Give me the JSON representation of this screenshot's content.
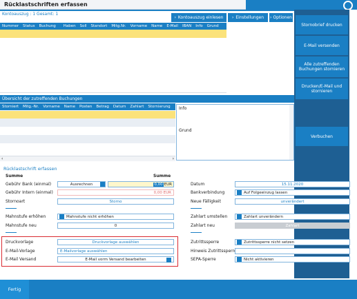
{
  "window": {
    "title": "Rücklastschriften erfassen"
  },
  "statement": {
    "text": "Kontoauszug : 1 Gesamt: 1"
  },
  "toolbar": {
    "read_statement": "Kontoauszug einlesen",
    "settings": "Einstellungen",
    "options": "Optionen"
  },
  "table1": {
    "columns": [
      "Nummer",
      "Status",
      "Buchung",
      "Haben",
      "Soll",
      "Standort",
      "Mitg.Nr.",
      "Vorname",
      "Name",
      "E-Mail",
      "IBAN",
      "Info",
      "Grund"
    ]
  },
  "side_buttons": {
    "storno_print": "Stornobrief drucken",
    "email_send": "E-Mail versenden",
    "cancel_all": "Alle zutreffenden Buchungen stornieren",
    "print_email_cancel": "Drucken/E-Mail und stornieren",
    "book": "Verbuchen"
  },
  "overview": {
    "title": "Übersicht der zutreffenden Buchungen",
    "columns": [
      "Storniert",
      "Mitg.-Nr.",
      "Vorname",
      "Name",
      "Posten",
      "Betrag",
      "Datum",
      "Zahlart",
      "Stornierung"
    ],
    "info_label": "Info",
    "reason_label": "Grund"
  },
  "form": {
    "section_title": "Rücklastschrift erfassen",
    "sum_left": "Summe",
    "sum_right": "Summe",
    "bank_fee_label": "Gebühr Bank (einmal)",
    "calc_button": "Ausrechnen",
    "bank_fee_value": "0,00",
    "bank_fee_currency": "EUR",
    "internal_fee_label": "Gebühr Intern (einmal)",
    "internal_fee_value": "0,00 EUR",
    "storno_type_label": "Stornoart",
    "storno_type_value": "Storno",
    "dunning_raise_label": "Mahnstufe erhöhen",
    "dunning_raise_value": "Mahnstufe nicht erhöhen",
    "dunning_new_label": "Mahnstufe neu",
    "dunning_new_value": "0",
    "print_template_label": "Druckvorlage",
    "print_template_value": "Druckvorlage auswählen",
    "email_template_label": "E-Mail-Vorlage",
    "email_template_value": "E-Mailvorlage auswählen",
    "email_send_label": "E-Mail Versand",
    "email_send_value": "E-Mail vorm Versand bearbeiten",
    "date_label": "Datum",
    "date_value": "15.11.2020",
    "bank_link_label": "Bankverbindung",
    "bank_link_value": "Auf Folgeeinzug lassen",
    "new_due_label": "Neue Fälligkeit",
    "new_due_value": "unverändert",
    "payment_change_label": "Zahlart umstellen",
    "payment_change_value": "Zahlart unverändern",
    "payment_new_label": "Zahlart neu",
    "payment_new_value": "Zahlart",
    "access_block_label": "Zutrittssperre",
    "access_block_value": "Zutrittssperre nicht setzen",
    "access_hint_label": "Hinweis Zutrittssperre",
    "sepa_block_label": "SEPA-Sperre",
    "sepa_block_value": "Nicht aktivieren"
  },
  "footer": {
    "done": "Fertig"
  },
  "colors": {
    "accent": "#1a7fc4",
    "dark": "#1e5f93",
    "highlight": "#fbe27a",
    "alert": "#d9292f"
  }
}
